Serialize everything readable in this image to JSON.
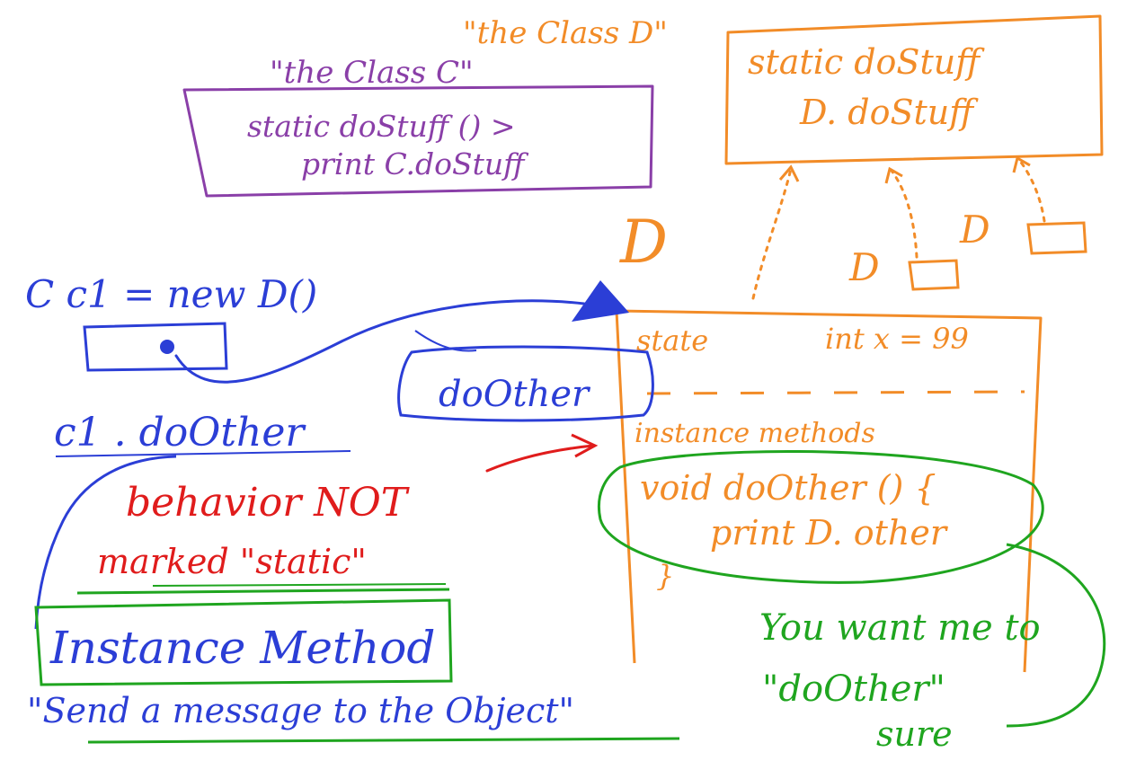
{
  "colors": {
    "purple": "#8a3fa8",
    "orange": "#f28c28",
    "blue": "#2b3ed6",
    "red": "#e01c1c",
    "green": "#1fa51f"
  },
  "class_c": {
    "title": "\"the Class C\"",
    "line1": "static doStuff () >",
    "line2": "print C.doStuff"
  },
  "class_d": {
    "title": "\"the Class D\"",
    "line1": "static doStuff",
    "line2": "D. doStuff"
  },
  "d_labels": {
    "big_d": "D",
    "d_small_1": "D",
    "d_small_2": "D"
  },
  "object_d": {
    "state_label": "state",
    "state_value": "int x = 99",
    "methods_label": "instance methods",
    "method_sig": "void doOther () {",
    "method_body": "print D. other",
    "method_close": "}"
  },
  "code": {
    "declaration": "C  c1 = new D()",
    "call": "c1 . doOther",
    "message_bubble": "doOther"
  },
  "notes": {
    "behavior_line1": "behavior NOT",
    "behavior_line2": "marked \"static\"",
    "instance_method": "Instance Method",
    "send_message": "\"Send a message to the Object\"",
    "want_line1": "You want me to",
    "want_line2": "\"doOther\"",
    "want_line3": "sure"
  }
}
